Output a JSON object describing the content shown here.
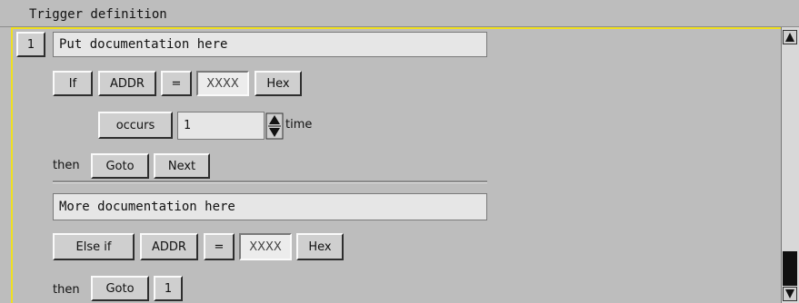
{
  "window": {
    "title": "Trigger definition"
  },
  "state1": {
    "number": "1",
    "documentation": "Put documentation here",
    "if_label": "If",
    "address_label": "ADDR",
    "equals_label": "=",
    "pattern_value": "XXXX",
    "base_label": "Hex",
    "occurs_label": "occurs",
    "occurs_count": "1",
    "time_label": "time",
    "then_label": "then",
    "goto_label": "Goto",
    "goto_target": "Next"
  },
  "else_branch": {
    "documentation": "More documentation here",
    "else_if_label": "Else if",
    "address_label": "ADDR",
    "equals_label": "=",
    "pattern_value": "XXXX",
    "base_label": "Hex",
    "then_label": "then",
    "goto_label": "Goto",
    "goto_target": "1"
  },
  "colors": {
    "highlight_border": "#f0e020",
    "background": "#bdbdbd"
  },
  "icons": {
    "spinner": "up-down-arrows-icon",
    "scroll_up": "triangle-up-icon",
    "scroll_down": "triangle-down-icon"
  }
}
